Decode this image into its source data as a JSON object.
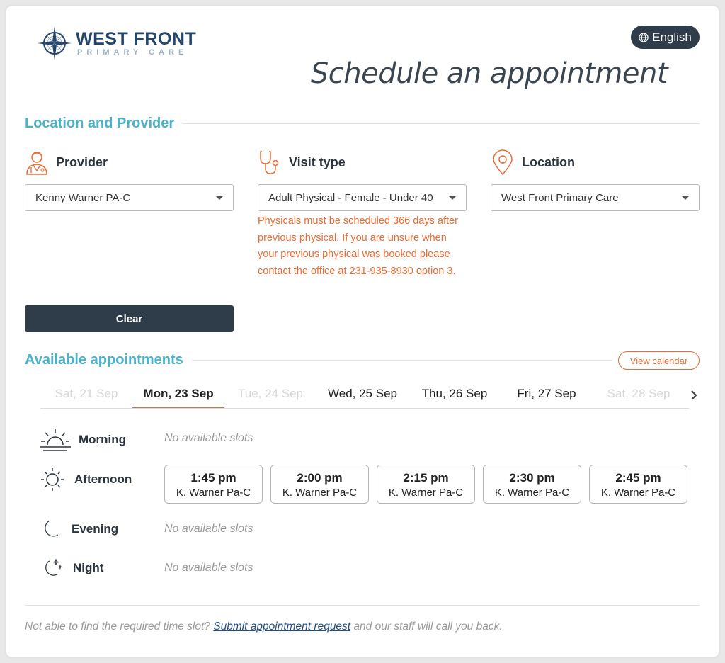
{
  "brand": {
    "name_line1": "WEST FRONT",
    "name_line2": "PRIMARY CARE",
    "logo_icon": "compass-rose-icon"
  },
  "language": {
    "label": "English",
    "icon": "globe-icon"
  },
  "title": "Schedule an appointment",
  "location_provider": {
    "heading": "Location and Provider",
    "provider": {
      "label": "Provider",
      "value": "Kenny Warner PA-C",
      "icon": "doctor-icon"
    },
    "visit_type": {
      "label": "Visit type",
      "value": "Adult Physical - Female - Under 40",
      "icon": "stethoscope-icon",
      "warning": "Physicals must be scheduled 366 days after previous physical. If you are unsure when your previous physical was booked please contact the office at 231-935-8930 option 3."
    },
    "location": {
      "label": "Location",
      "value": "West Front Primary Care",
      "icon": "map-pin-icon"
    },
    "clear_label": "Clear"
  },
  "appointments": {
    "heading": "Available appointments",
    "view_calendar_label": "View calendar",
    "days": [
      {
        "label": "Sat, 21 Sep",
        "state": "disabled"
      },
      {
        "label": "Mon, 23 Sep",
        "state": "active"
      },
      {
        "label": "Tue, 24 Sep",
        "state": "disabled"
      },
      {
        "label": "Wed, 25 Sep",
        "state": "enabled"
      },
      {
        "label": "Thu, 26 Sep",
        "state": "enabled"
      },
      {
        "label": "Fri, 27 Sep",
        "state": "enabled"
      },
      {
        "label": "Sat, 28 Sep",
        "state": "disabled"
      }
    ],
    "periods": {
      "morning": {
        "label": "Morning",
        "empty_text": "No available slots",
        "icon": "sunrise-icon"
      },
      "afternoon": {
        "label": "Afternoon",
        "icon": "sun-icon"
      },
      "evening": {
        "label": "Evening",
        "empty_text": "No available slots",
        "icon": "moon-icon"
      },
      "night": {
        "label": "Night",
        "empty_text": "No available slots",
        "icon": "moon-stars-icon"
      }
    },
    "afternoon_slots": [
      {
        "time": "1:45 pm",
        "provider": "K. Warner Pa-C"
      },
      {
        "time": "2:00 pm",
        "provider": "K. Warner Pa-C"
      },
      {
        "time": "2:15 pm",
        "provider": "K. Warner Pa-C"
      },
      {
        "time": "2:30 pm",
        "provider": "K. Warner Pa-C"
      },
      {
        "time": "2:45 pm",
        "provider": "K. Warner Pa-C"
      }
    ]
  },
  "footer": {
    "prefix": "Not able to find the required time slot?",
    "link": "Submit appointment request",
    "suffix": "and our staff will call you back."
  },
  "colors": {
    "accent_teal": "#4ab3c9",
    "accent_orange": "#ea6b33",
    "dark_slate": "#2f3d4a",
    "brand_navy": "#24466c"
  }
}
